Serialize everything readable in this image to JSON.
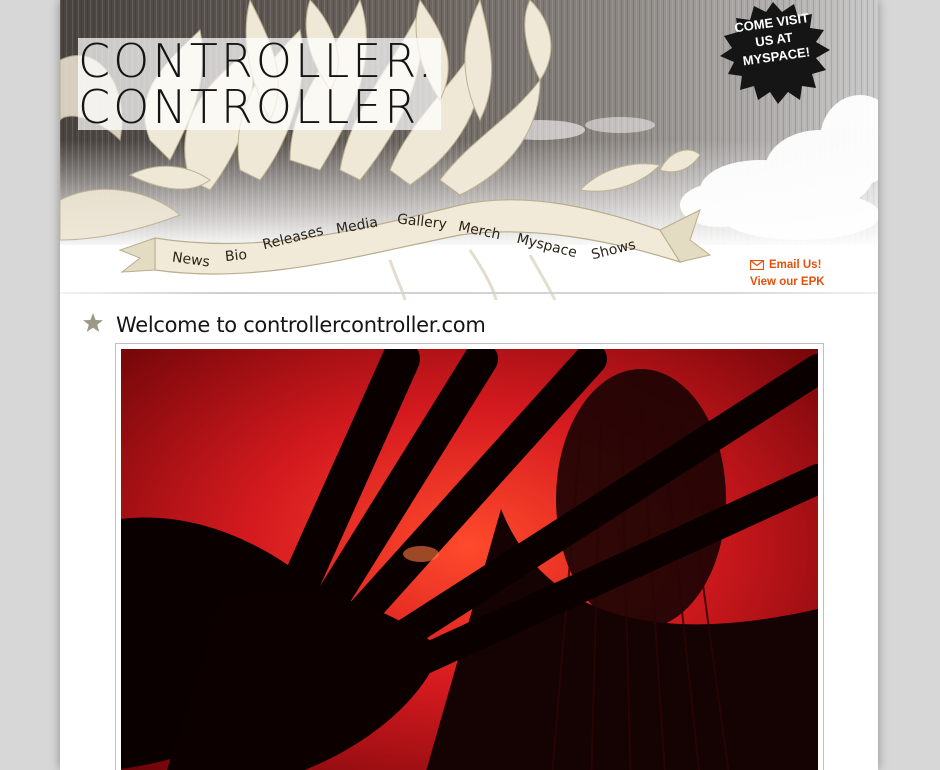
{
  "site": {
    "logo_line1": "CONTROLLER.",
    "logo_line2": "CONTROLLER"
  },
  "promo": {
    "line1": "COME VISIT",
    "line2": "US AT",
    "line3": "MYSPACE!"
  },
  "nav": {
    "items": [
      "News",
      "Bio",
      "Releases",
      "Media",
      "Gallery",
      "Merch",
      "Myspace",
      "Shows"
    ]
  },
  "contact": {
    "email_label": "Email Us!",
    "epk_label": "View our EPK",
    "icons": [
      "envelope-icon"
    ]
  },
  "main": {
    "title": "Welcome to controllercontroller.com"
  },
  "colors": {
    "accent": "#e2520b",
    "photo_red": "#c8141a"
  }
}
